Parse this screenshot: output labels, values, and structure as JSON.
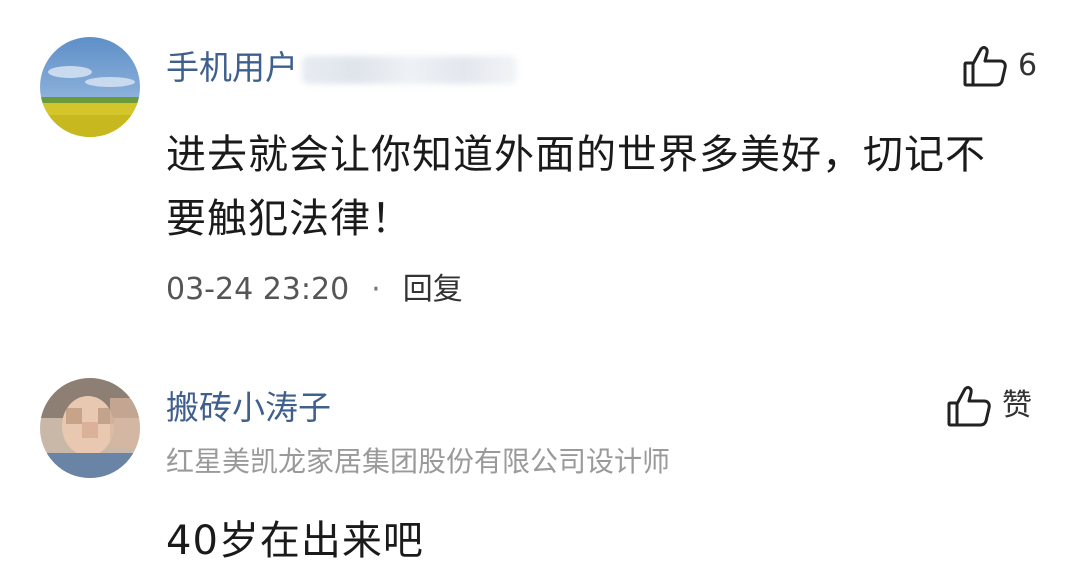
{
  "comments": [
    {
      "username": "手机用户",
      "like_count": "6",
      "content_line1": "进去就会让你知道外面的世界多美好，切记不",
      "content_line2": "要触犯法律！",
      "time": "03-24 23:20",
      "separator": "·",
      "reply_label": "回复"
    },
    {
      "username": "搬砖小涛子",
      "like_label": "赞",
      "subtitle": "红星美凯龙家居集团股份有限公司设计师",
      "content_line1": "40岁在出来吧"
    }
  ],
  "icons": {
    "like": "thumbs-up-icon"
  },
  "colors": {
    "username": "#3f5f8f",
    "text": "#1a1a1a",
    "meta": "#555555",
    "subtitle": "#9a9a9a"
  }
}
